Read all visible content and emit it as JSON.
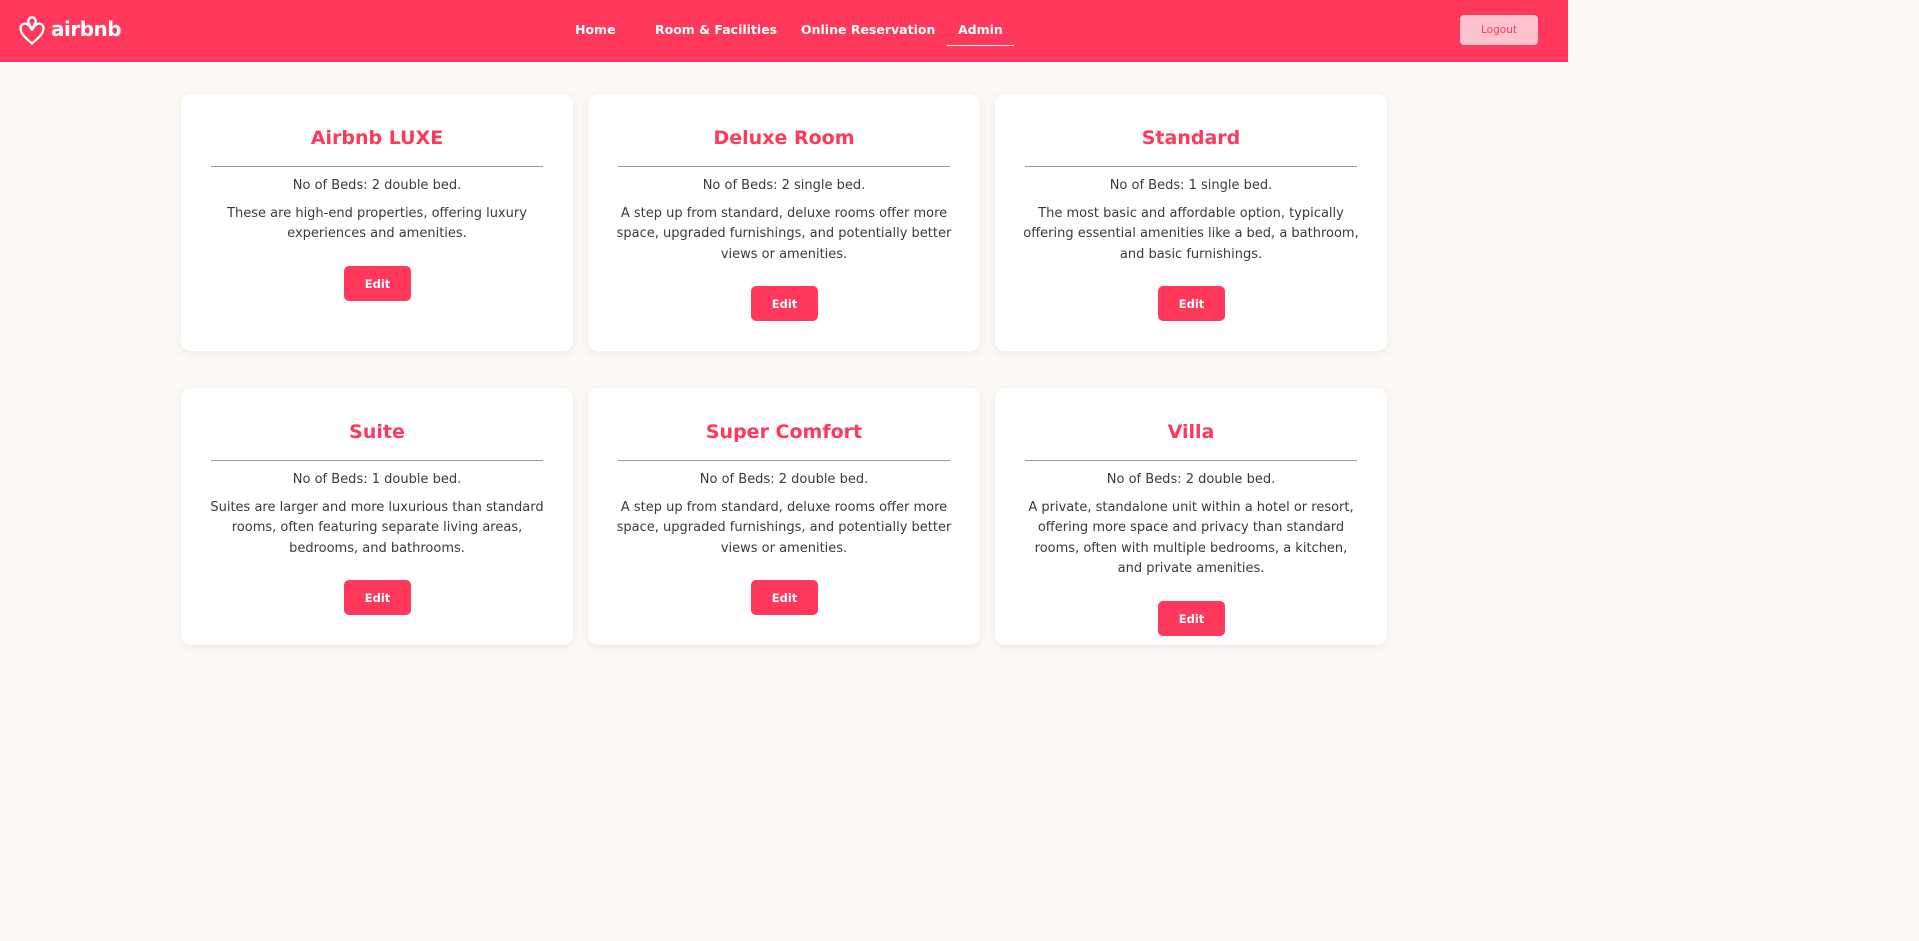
{
  "brand": {
    "name": "airbnb",
    "color": "#ff385c"
  },
  "nav": {
    "home": "Home",
    "rooms": "Room & Facilities",
    "reservation": "Online Reservation",
    "admin": "Admin",
    "active": "Admin"
  },
  "header": {
    "logout_label": "Logout"
  },
  "rooms": [
    {
      "title": "Airbnb LUXE",
      "beds": "No of Beds: 2 double bed.",
      "description": "These are high-end properties, offering luxury experiences and amenities.",
      "edit_label": "Edit"
    },
    {
      "title": "Deluxe Room",
      "beds": "No of Beds: 2 single bed.",
      "description": "A step up from standard, deluxe rooms offer more space, upgraded furnishings, and potentially better views or amenities.",
      "edit_label": "Edit"
    },
    {
      "title": "Standard",
      "beds": "No of Beds: 1 single bed.",
      "description": "The most basic and affordable option, typically offering essential amenities like a bed, a bathroom, and basic furnishings.",
      "edit_label": "Edit"
    },
    {
      "title": "Suite",
      "beds": "No of Beds: 1 double bed.",
      "description": "Suites are larger and more luxurious than standard rooms, often featuring separate living areas, bedrooms, and bathrooms.",
      "edit_label": "Edit"
    },
    {
      "title": "Super Comfort",
      "beds": "No of Beds: 2 double bed.",
      "description": "A step up from standard, deluxe rooms offer more space, upgraded furnishings, and potentially better views or amenities.",
      "edit_label": "Edit"
    },
    {
      "title": "Villa",
      "beds": "No of Beds: 2 double bed.",
      "description": "A private, standalone unit within a hotel or resort, offering more space and privacy than standard rooms, often with multiple bedrooms, a kitchen, and private amenities.",
      "edit_label": "Edit"
    }
  ]
}
